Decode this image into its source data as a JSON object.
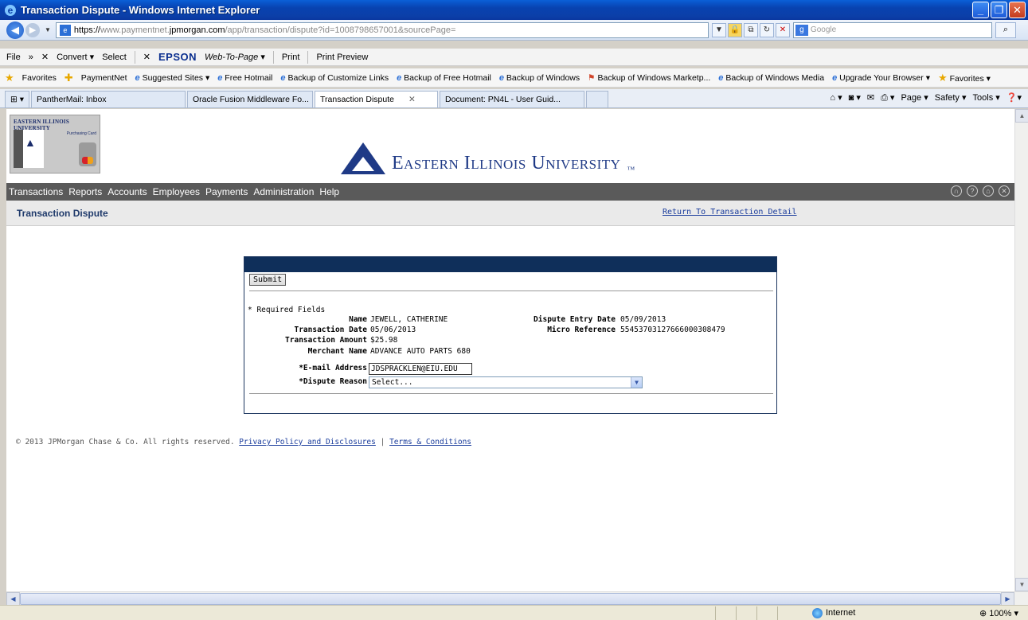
{
  "window": {
    "title": "Transaction Dispute - Windows Internet Explorer"
  },
  "address": {
    "scheme": "https://",
    "host_prefix": "www.paymentnet.",
    "host_main": "jpmorgan.com",
    "path": "/app/transaction/dispute?id=1008798657001&sourcePage=",
    "search_placeholder": "Google"
  },
  "command_bar": {
    "file": "File",
    "convert": "Convert",
    "select": "Select",
    "epson": "EPSON",
    "web_to_page": "Web-To-Page",
    "print": "Print",
    "print_preview": "Print Preview"
  },
  "favorites_bar": {
    "favorites_label": "Favorites",
    "items": [
      "PaymentNet",
      "Suggested Sites",
      "Free Hotmail",
      "Backup of Customize Links",
      "Backup of Free Hotmail",
      "Backup of Windows",
      "Backup of Windows Marketp...",
      "Backup of Windows Media",
      "Upgrade Your Browser",
      "Favorites"
    ]
  },
  "tabs": [
    {
      "label": "PantherMail: Inbox"
    },
    {
      "label": "Oracle Fusion Middleware Fo..."
    },
    {
      "label": "Transaction Dispute"
    },
    {
      "label": "Document: PN4L - User Guid..."
    }
  ],
  "tab_tools": {
    "page": "Page",
    "safety": "Safety",
    "tools": "Tools"
  },
  "site": {
    "small_logo_title": "EASTERN ILLINOIS UNIVERSITY",
    "small_logo_subtitle": "Purchasing Card",
    "main_logo_text": "Eastern Illinois University",
    "main_logo_tm": "™"
  },
  "app_nav": [
    "Transactions",
    "Reports",
    "Accounts",
    "Employees",
    "Payments",
    "Administration",
    "Help"
  ],
  "page": {
    "title": "Transaction Dispute",
    "return_link": "Return To Transaction Detail"
  },
  "form": {
    "submit_label": "Submit",
    "required_note": "* Required Fields",
    "fields": {
      "name_label": "Name",
      "name_value": "JEWELL, CATHERINE",
      "dispute_entry_date_label": "Dispute Entry Date",
      "dispute_entry_date_value": "05/09/2013",
      "transaction_date_label": "Transaction Date",
      "transaction_date_value": "05/06/2013",
      "micro_reference_label": "Micro Reference",
      "micro_reference_value": "55453703127666000308479",
      "transaction_amount_label": "Transaction Amount",
      "transaction_amount_value": "$25.98",
      "merchant_name_label": "Merchant Name",
      "merchant_name_value": "ADVANCE AUTO PARTS 680",
      "email_label": "*E-mail Address",
      "email_value": "JDSPRACKLEN@EIU.EDU",
      "dispute_reason_label": "*Dispute Reason",
      "dispute_reason_value": "Select..."
    }
  },
  "footer": {
    "copyright": "© 2013 JPMorgan Chase & Co. All rights reserved.",
    "privacy_link": "Privacy Policy and Disclosures",
    "separator": "|",
    "terms_link": "Terms & Conditions"
  },
  "status": {
    "zone": "Internet",
    "zoom": "100%"
  }
}
